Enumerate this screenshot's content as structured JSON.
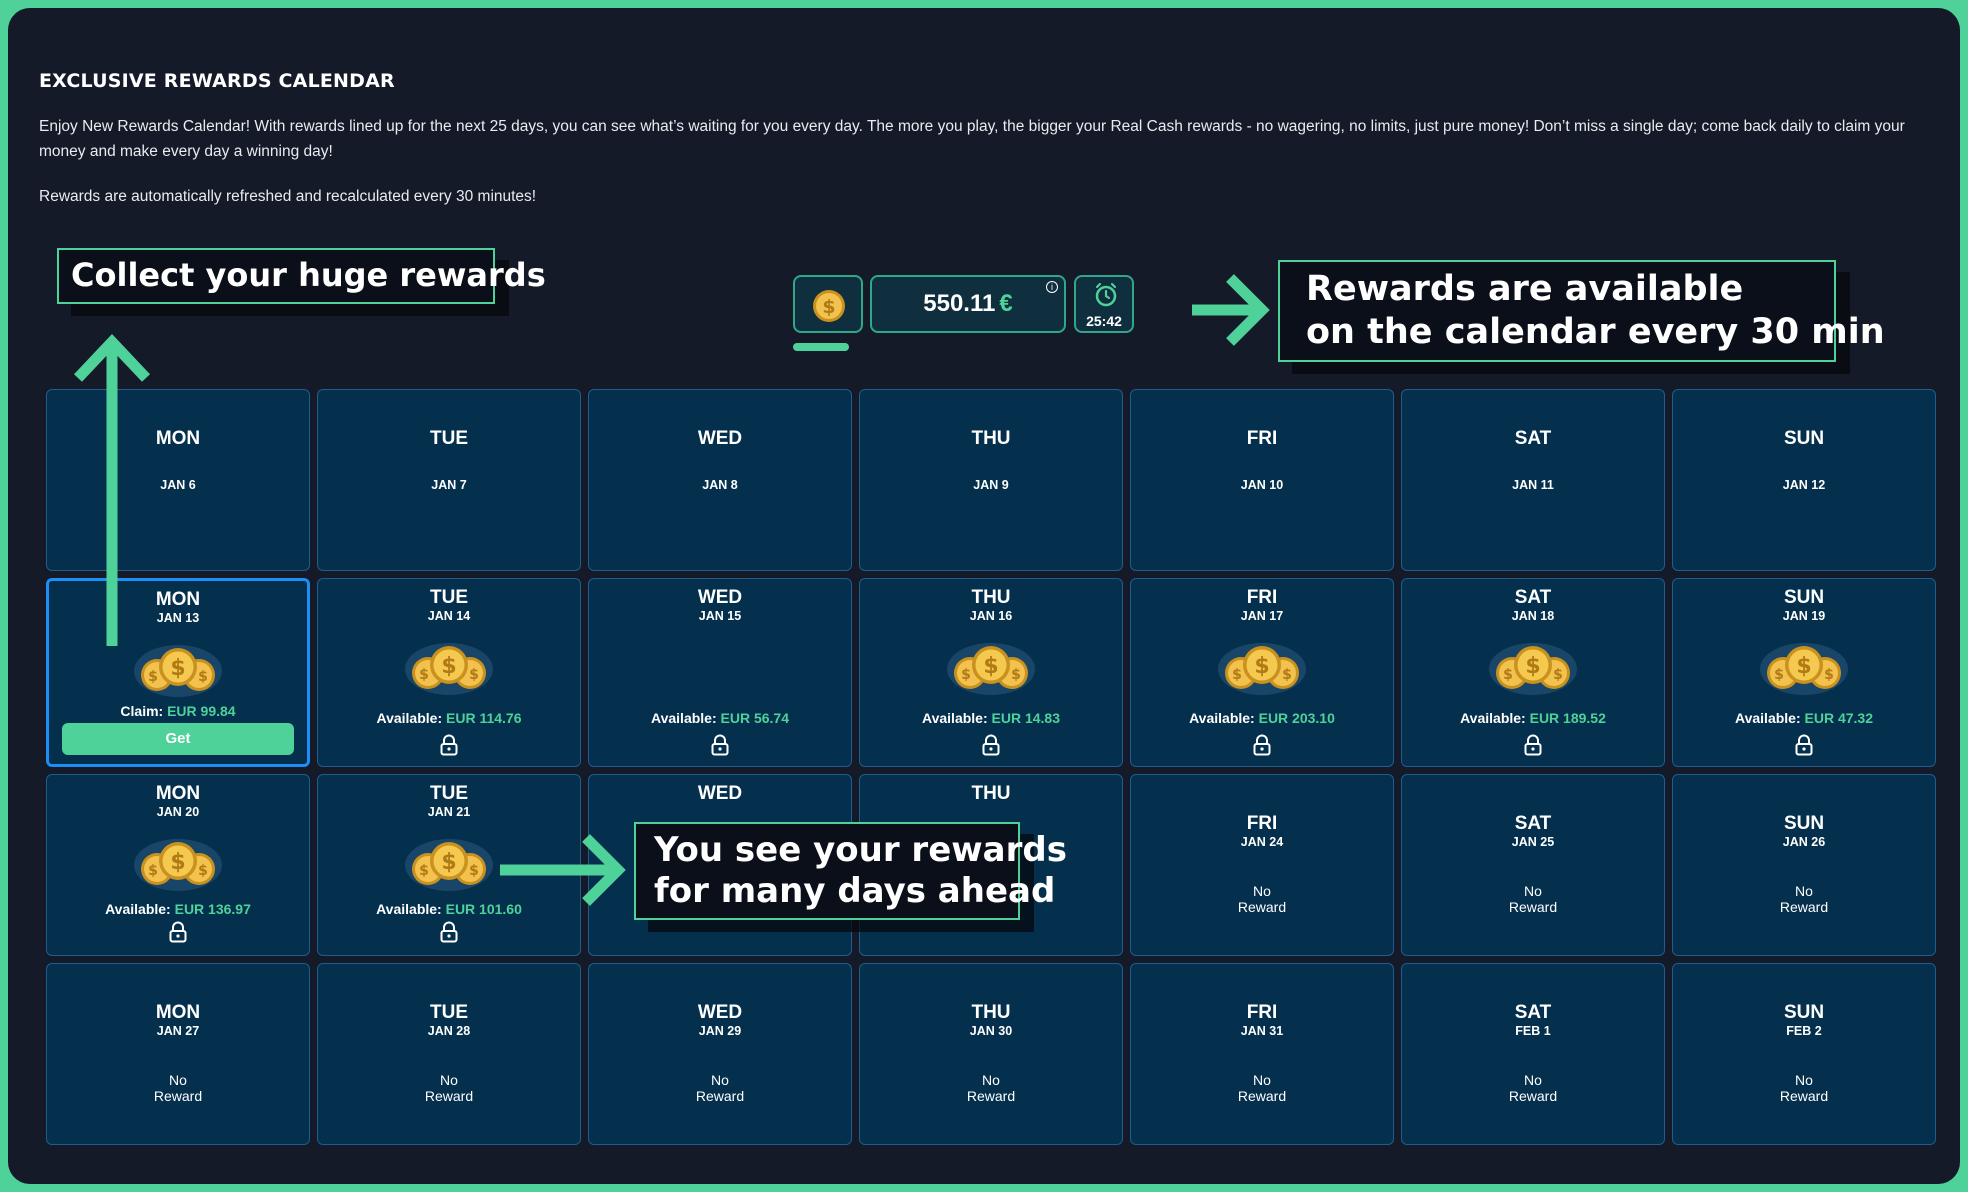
{
  "header": {
    "title": "EXCLUSIVE REWARDS CALENDAR",
    "description": "Enjoy New Rewards Calendar! With rewards lined up for the next 25 days, you can see what’s waiting for you every day. The more you play, the bigger your Real Cash rewards - no wagering, no limits, just pure money! Don’t miss a single day; come back daily to claim your money and make every day a winning day!",
    "note": "Rewards are automatically refreshed and recalculated every 30 minutes!"
  },
  "widget": {
    "balance": "550.11",
    "currency_symbol": "€",
    "info_symbol": "i",
    "timer": "25:42"
  },
  "callouts": {
    "collect": "Collect your huge rewards",
    "available_line1": "Rewards are available",
    "available_line2": "on the calendar every 30 min",
    "ahead_line1": "You see your rewards",
    "ahead_line2": "for many days ahead"
  },
  "labels": {
    "available": "Available:",
    "claim": "Claim:",
    "get": "Get",
    "no": "No",
    "reward": "Reward"
  },
  "weeks": [
    [
      {
        "day": "MON",
        "date": "JAN 6",
        "state": "empty"
      },
      {
        "day": "TUE",
        "date": "JAN 7",
        "state": "empty"
      },
      {
        "day": "WED",
        "date": "JAN 8",
        "state": "empty"
      },
      {
        "day": "THU",
        "date": "JAN 9",
        "state": "empty"
      },
      {
        "day": "FRI",
        "date": "JAN 10",
        "state": "empty"
      },
      {
        "day": "SAT",
        "date": "JAN 11",
        "state": "empty"
      },
      {
        "day": "SUN",
        "date": "JAN 12",
        "state": "empty"
      }
    ],
    [
      {
        "day": "MON",
        "date": "JAN 13",
        "state": "claim",
        "amount": "EUR 99.84"
      },
      {
        "day": "TUE",
        "date": "JAN 14",
        "state": "available",
        "amount": "EUR 114.76"
      },
      {
        "day": "WED",
        "date": "JAN 15",
        "state": "available-nocoin",
        "amount": "EUR 56.74"
      },
      {
        "day": "THU",
        "date": "JAN 16",
        "state": "available",
        "amount": "EUR 14.83"
      },
      {
        "day": "FRI",
        "date": "JAN 17",
        "state": "available",
        "amount": "EUR 203.10"
      },
      {
        "day": "SAT",
        "date": "JAN 18",
        "state": "available",
        "amount": "EUR 189.52"
      },
      {
        "day": "SUN",
        "date": "JAN 19",
        "state": "available",
        "amount": "EUR 47.32"
      }
    ],
    [
      {
        "day": "MON",
        "date": "JAN 20",
        "state": "available",
        "amount": "EUR 136.97"
      },
      {
        "day": "TUE",
        "date": "JAN 21",
        "state": "available",
        "amount": "EUR 101.60"
      },
      {
        "day": "WED",
        "date": "",
        "state": "hidden"
      },
      {
        "day": "THU",
        "date": "",
        "state": "hidden"
      },
      {
        "day": "FRI",
        "date": "JAN 24",
        "state": "none"
      },
      {
        "day": "SAT",
        "date": "JAN 25",
        "state": "none"
      },
      {
        "day": "SUN",
        "date": "JAN 26",
        "state": "none"
      }
    ],
    [
      {
        "day": "MON",
        "date": "JAN 27",
        "state": "none"
      },
      {
        "day": "TUE",
        "date": "JAN 28",
        "state": "none"
      },
      {
        "day": "WED",
        "date": "JAN 29",
        "state": "none"
      },
      {
        "day": "THU",
        "date": "JAN 30",
        "state": "none"
      },
      {
        "day": "FRI",
        "date": "JAN 31",
        "state": "none"
      },
      {
        "day": "SAT",
        "date": "FEB 1",
        "state": "none"
      },
      {
        "day": "SUN",
        "date": "FEB 2",
        "state": "none"
      }
    ]
  ],
  "colors": {
    "accent": "#4fd19a",
    "cell_bg": "#04304d",
    "cell_border": "#1f5c90",
    "active_border": "#1d8ef5",
    "page_bg": "#141a27"
  }
}
